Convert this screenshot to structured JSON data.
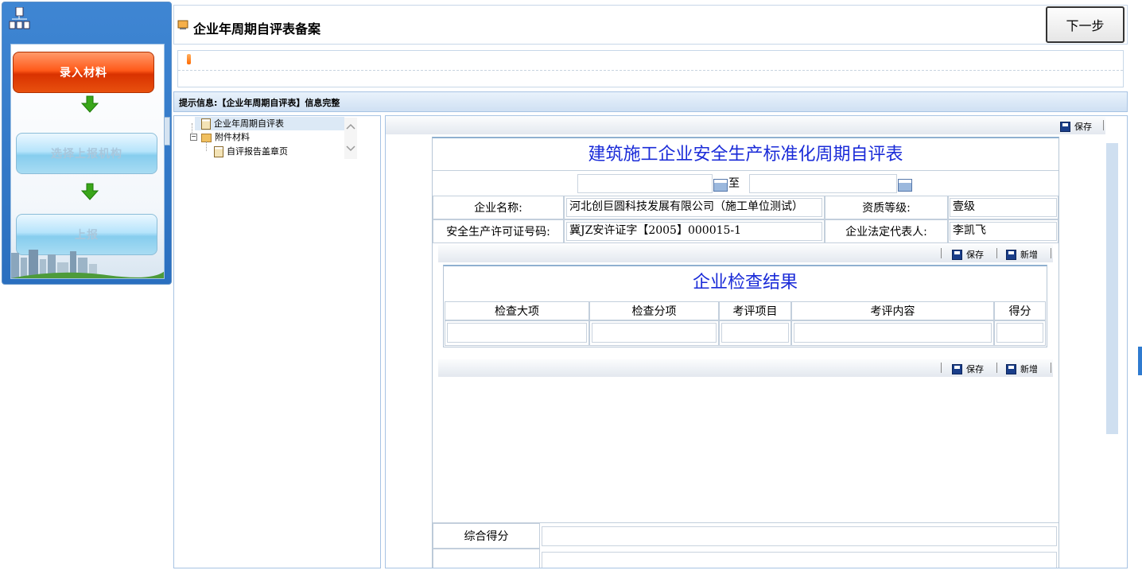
{
  "workflow": {
    "steps": [
      {
        "label": "录入材料",
        "state": "active"
      },
      {
        "label": "选择上报机构",
        "state": "disabled"
      },
      {
        "label": "上报",
        "state": "disabled"
      }
    ]
  },
  "header": {
    "title": "企业年周期自评表备案",
    "next_button": "下一步"
  },
  "hint": "提示信息:【企业年周期自评表】信息完整",
  "tree": {
    "items": [
      {
        "label": "企业年周期自评表",
        "icon": "document-icon",
        "selected": true
      },
      {
        "label": "附件材料",
        "icon": "folder-icon",
        "expanded": true
      },
      {
        "label": "自评报告盖章页",
        "icon": "document-icon"
      }
    ]
  },
  "toolbar": {
    "save": "保存",
    "add": "新增"
  },
  "form": {
    "title": "建筑施工企业安全生产标准化周期自评表",
    "date_to": "至",
    "date_from_value": "",
    "date_to_value": "",
    "company_name_label": "企业名称:",
    "company_name_value": "河北创巨圆科技发展有限公司（施工单位测试）",
    "qualification_label": "资质等级:",
    "qualification_value": "壹级",
    "license_label": "安全生产许可证号码:",
    "license_value": "冀JZ安许证字【2005】000015-1",
    "legal_rep_label": "企业法定代表人:",
    "legal_rep_value": "李凯飞",
    "check_section": {
      "title": "企业检查结果",
      "columns": [
        "检查大项",
        "检查分项",
        "考评项目",
        "考评内容",
        "得分"
      ]
    },
    "total_score_label": "综合得分",
    "total_score_value": ""
  }
}
